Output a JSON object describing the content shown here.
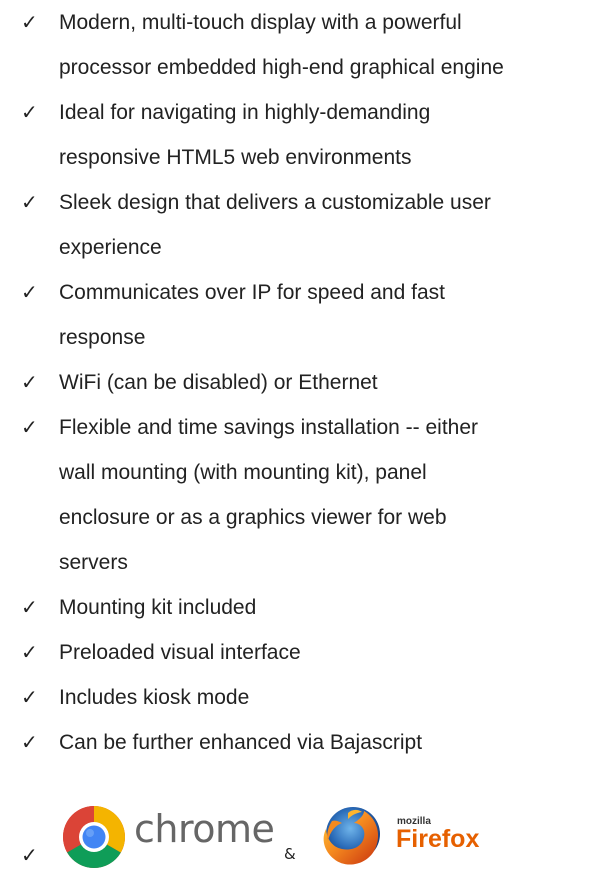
{
  "check_mark": "✓",
  "features": [
    {
      "lines": [
        "Modern, multi-touch display with a powerful",
        "processor embedded high-end graphical engine"
      ]
    },
    {
      "lines": [
        "Ideal for navigating in highly-demanding",
        "responsive HTML5 web environments"
      ]
    },
    {
      "lines": [
        "Sleek design that delivers a customizable user",
        "experience"
      ]
    },
    {
      "lines": [
        "Communicates over IP for speed and fast",
        "response"
      ]
    },
    {
      "lines": [
        "WiFi (can be disabled) or Ethernet"
      ]
    },
    {
      "lines": [
        "Flexible and time savings installation -- either",
        "wall mounting (with mounting kit), panel",
        "enclosure or as a graphics viewer for web",
        "servers"
      ]
    },
    {
      "lines": [
        "Mounting kit included"
      ]
    },
    {
      "lines": [
        "Preloaded visual interface"
      ]
    },
    {
      "lines": [
        "Includes kiosk mode"
      ]
    },
    {
      "lines": [
        "Can be further enhanced via Bajascript"
      ]
    }
  ],
  "browsers": {
    "chrome_label": "chrome",
    "separator": "&",
    "mozilla_label": "mozilla",
    "firefox_label": "Firefox",
    "icons": [
      "chrome-logo",
      "firefox-logo"
    ]
  },
  "colors": {
    "text": "#222222",
    "chrome_text": "#666666",
    "firefox_text": "#e66000"
  }
}
